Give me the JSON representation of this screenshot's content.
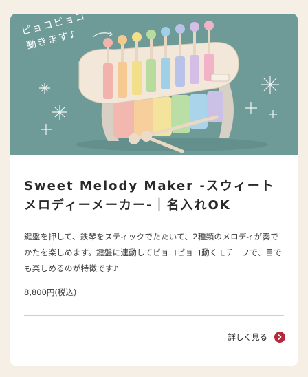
{
  "product": {
    "image": {
      "alt_overlay_line1": "ピョコピョコ",
      "alt_overlay_line2": "動きます♪",
      "background_color": "#6e9b98",
      "subject": "wooden-xylophone-toy-icon"
    },
    "title": "Sweet Melody Maker -スウィートメロディーメーカー-｜名入れOK",
    "description": "鍵盤を押して、鉄琴をスティックでたたいて、2種類のメロディが奏でかたを楽しめます。鍵盤に連動してピョコピョコ動くモチーフで、目でも楽しめるのが特徴です♪",
    "price": "8,800円(税込)",
    "more_link": {
      "label": "詳しく見る",
      "icon": "chevron-right-circle-icon",
      "accent_color": "#b5283a"
    }
  },
  "page": {
    "background_color": "#f5efe6"
  }
}
